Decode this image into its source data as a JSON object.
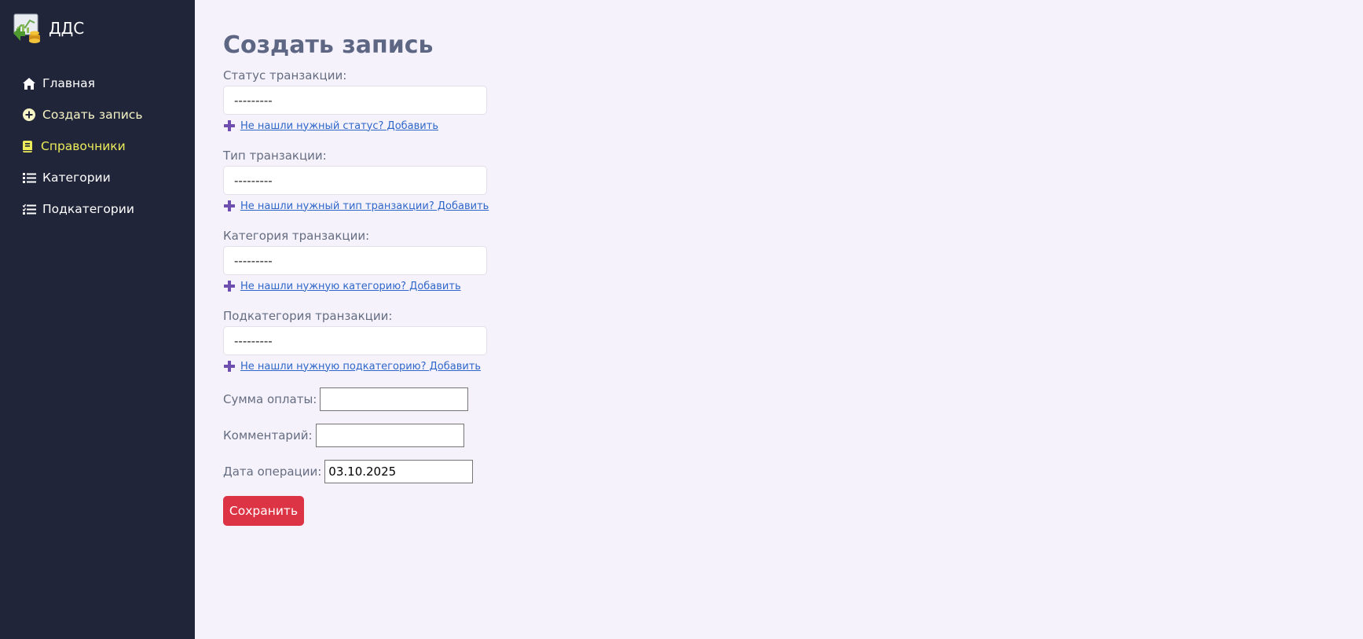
{
  "app": {
    "title": "ДДС",
    "logo_icon": "finance-chart-coins-icon"
  },
  "sidebar": {
    "items": [
      {
        "label": "Главная",
        "icon": "home-icon"
      },
      {
        "label": "Создать запись",
        "icon": "plus-circle-icon"
      },
      {
        "label": "Справочники",
        "icon": "book-icon"
      },
      {
        "label": "Категории",
        "icon": "list-icon"
      },
      {
        "label": "Подкатегории",
        "icon": "list-check-icon"
      }
    ]
  },
  "form": {
    "title": "Создать запись",
    "status": {
      "label": "Статус транзакции:",
      "value": "---------",
      "add_link": "Не нашли нужный статус? Добавить"
    },
    "type": {
      "label": "Тип транзакции:",
      "value": "---------",
      "add_link": "Не нашли нужный тип транзакции? Добавить"
    },
    "category": {
      "label": "Категория транзакции:",
      "value": "---------",
      "add_link": "Не нашли нужную категорию? Добавить"
    },
    "subcategory": {
      "label": "Подкатегория транзакции:",
      "value": "---------",
      "add_link": "Не нашли нужную подкатегорию? Добавить"
    },
    "amount": {
      "label": "Сумма оплаты:",
      "value": ""
    },
    "comment": {
      "label": "Комментарий:",
      "value": ""
    },
    "date": {
      "label": "Дата операции:",
      "value": "03.10.2025"
    },
    "save_label": "Сохранить"
  },
  "colors": {
    "sidebar_bg": "#212539",
    "page_bg": "#f5f2fc",
    "accent_yellow": "#ecec5a",
    "link_blue": "#2f67c9",
    "plus_purple": "#6e4fb0",
    "save_red": "#dc3445"
  }
}
